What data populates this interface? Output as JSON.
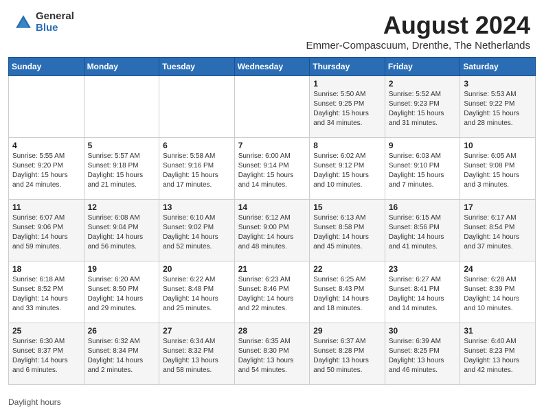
{
  "header": {
    "logo_general": "General",
    "logo_blue": "Blue",
    "month_title": "August 2024",
    "location": "Emmer-Compascuum, Drenthe, The Netherlands"
  },
  "calendar": {
    "days_of_week": [
      "Sunday",
      "Monday",
      "Tuesday",
      "Wednesday",
      "Thursday",
      "Friday",
      "Saturday"
    ],
    "weeks": [
      [
        {
          "day": "",
          "content": ""
        },
        {
          "day": "",
          "content": ""
        },
        {
          "day": "",
          "content": ""
        },
        {
          "day": "",
          "content": ""
        },
        {
          "day": "1",
          "content": "Sunrise: 5:50 AM\nSunset: 9:25 PM\nDaylight: 15 hours\nand 34 minutes."
        },
        {
          "day": "2",
          "content": "Sunrise: 5:52 AM\nSunset: 9:23 PM\nDaylight: 15 hours\nand 31 minutes."
        },
        {
          "day": "3",
          "content": "Sunrise: 5:53 AM\nSunset: 9:22 PM\nDaylight: 15 hours\nand 28 minutes."
        }
      ],
      [
        {
          "day": "4",
          "content": "Sunrise: 5:55 AM\nSunset: 9:20 PM\nDaylight: 15 hours\nand 24 minutes."
        },
        {
          "day": "5",
          "content": "Sunrise: 5:57 AM\nSunset: 9:18 PM\nDaylight: 15 hours\nand 21 minutes."
        },
        {
          "day": "6",
          "content": "Sunrise: 5:58 AM\nSunset: 9:16 PM\nDaylight: 15 hours\nand 17 minutes."
        },
        {
          "day": "7",
          "content": "Sunrise: 6:00 AM\nSunset: 9:14 PM\nDaylight: 15 hours\nand 14 minutes."
        },
        {
          "day": "8",
          "content": "Sunrise: 6:02 AM\nSunset: 9:12 PM\nDaylight: 15 hours\nand 10 minutes."
        },
        {
          "day": "9",
          "content": "Sunrise: 6:03 AM\nSunset: 9:10 PM\nDaylight: 15 hours\nand 7 minutes."
        },
        {
          "day": "10",
          "content": "Sunrise: 6:05 AM\nSunset: 9:08 PM\nDaylight: 15 hours\nand 3 minutes."
        }
      ],
      [
        {
          "day": "11",
          "content": "Sunrise: 6:07 AM\nSunset: 9:06 PM\nDaylight: 14 hours\nand 59 minutes."
        },
        {
          "day": "12",
          "content": "Sunrise: 6:08 AM\nSunset: 9:04 PM\nDaylight: 14 hours\nand 56 minutes."
        },
        {
          "day": "13",
          "content": "Sunrise: 6:10 AM\nSunset: 9:02 PM\nDaylight: 14 hours\nand 52 minutes."
        },
        {
          "day": "14",
          "content": "Sunrise: 6:12 AM\nSunset: 9:00 PM\nDaylight: 14 hours\nand 48 minutes."
        },
        {
          "day": "15",
          "content": "Sunrise: 6:13 AM\nSunset: 8:58 PM\nDaylight: 14 hours\nand 45 minutes."
        },
        {
          "day": "16",
          "content": "Sunrise: 6:15 AM\nSunset: 8:56 PM\nDaylight: 14 hours\nand 41 minutes."
        },
        {
          "day": "17",
          "content": "Sunrise: 6:17 AM\nSunset: 8:54 PM\nDaylight: 14 hours\nand 37 minutes."
        }
      ],
      [
        {
          "day": "18",
          "content": "Sunrise: 6:18 AM\nSunset: 8:52 PM\nDaylight: 14 hours\nand 33 minutes."
        },
        {
          "day": "19",
          "content": "Sunrise: 6:20 AM\nSunset: 8:50 PM\nDaylight: 14 hours\nand 29 minutes."
        },
        {
          "day": "20",
          "content": "Sunrise: 6:22 AM\nSunset: 8:48 PM\nDaylight: 14 hours\nand 25 minutes."
        },
        {
          "day": "21",
          "content": "Sunrise: 6:23 AM\nSunset: 8:46 PM\nDaylight: 14 hours\nand 22 minutes."
        },
        {
          "day": "22",
          "content": "Sunrise: 6:25 AM\nSunset: 8:43 PM\nDaylight: 14 hours\nand 18 minutes."
        },
        {
          "day": "23",
          "content": "Sunrise: 6:27 AM\nSunset: 8:41 PM\nDaylight: 14 hours\nand 14 minutes."
        },
        {
          "day": "24",
          "content": "Sunrise: 6:28 AM\nSunset: 8:39 PM\nDaylight: 14 hours\nand 10 minutes."
        }
      ],
      [
        {
          "day": "25",
          "content": "Sunrise: 6:30 AM\nSunset: 8:37 PM\nDaylight: 14 hours\nand 6 minutes."
        },
        {
          "day": "26",
          "content": "Sunrise: 6:32 AM\nSunset: 8:34 PM\nDaylight: 14 hours\nand 2 minutes."
        },
        {
          "day": "27",
          "content": "Sunrise: 6:34 AM\nSunset: 8:32 PM\nDaylight: 13 hours\nand 58 minutes."
        },
        {
          "day": "28",
          "content": "Sunrise: 6:35 AM\nSunset: 8:30 PM\nDaylight: 13 hours\nand 54 minutes."
        },
        {
          "day": "29",
          "content": "Sunrise: 6:37 AM\nSunset: 8:28 PM\nDaylight: 13 hours\nand 50 minutes."
        },
        {
          "day": "30",
          "content": "Sunrise: 6:39 AM\nSunset: 8:25 PM\nDaylight: 13 hours\nand 46 minutes."
        },
        {
          "day": "31",
          "content": "Sunrise: 6:40 AM\nSunset: 8:23 PM\nDaylight: 13 hours\nand 42 minutes."
        }
      ]
    ]
  },
  "footer": {
    "daylight_label": "Daylight hours"
  }
}
